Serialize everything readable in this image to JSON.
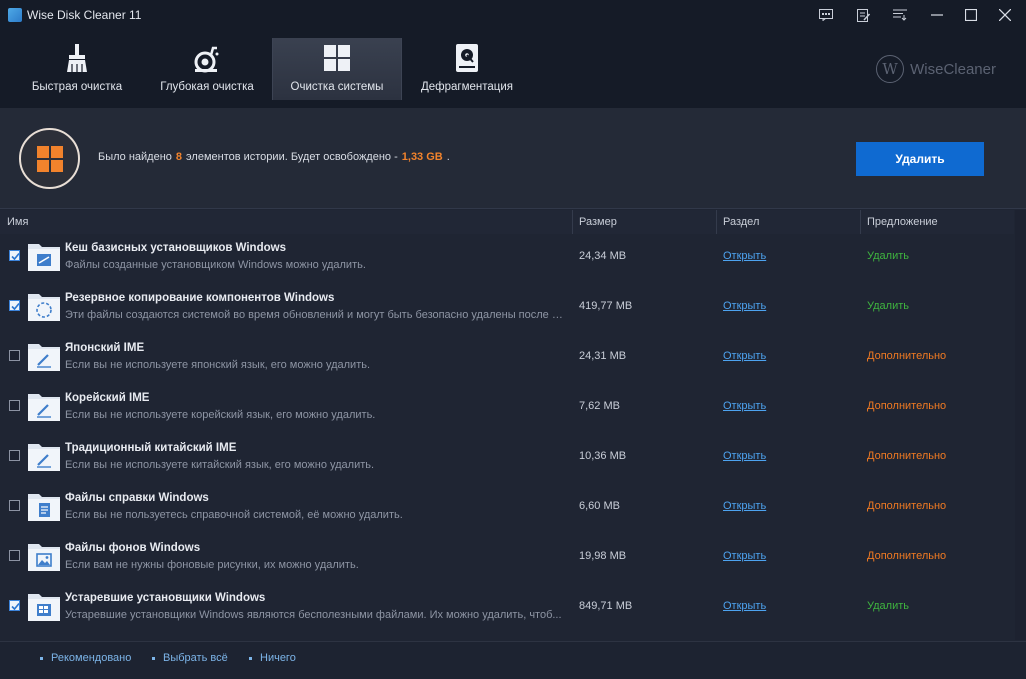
{
  "window": {
    "title": "Wise Disk Cleaner 11"
  },
  "tabs": [
    {
      "label": "Быстрая очистка",
      "icon": "broom-icon"
    },
    {
      "label": "Глубокая очистка",
      "icon": "vacuum-icon"
    },
    {
      "label": "Очистка системы",
      "icon": "windows-icon",
      "active": true
    },
    {
      "label": "Дефрагментация",
      "icon": "disk-icon"
    }
  ],
  "brand": {
    "logo_letter": "W",
    "name": "WiseCleaner"
  },
  "summary": {
    "text_before": "Было найдено",
    "count": "8",
    "text_middle": "элементов истории. Будет освобождено -",
    "size": "1,33 GB",
    "text_after": ".",
    "delete_label": "Удалить"
  },
  "table": {
    "headers": {
      "name": "Имя",
      "size": "Размер",
      "section": "Раздел",
      "suggestion": "Предложение"
    },
    "rows": [
      {
        "checked": true,
        "title": "Кеш базисных установщиков Windows",
        "desc": "Файлы созданные установщиком Windows можно удалить.",
        "size": "24,34 MB",
        "link": "Открыть",
        "suggestion": "Удалить",
        "suggestion_type": "delete",
        "icon": "installer-cache-icon"
      },
      {
        "checked": true,
        "title": "Резервное копирование компонентов Windows",
        "desc": "Эти файлы создаются системой во время обновлений и могут быть безопасно удалены после з...",
        "size": "419,77 MB",
        "link": "Открыть",
        "suggestion": "Удалить",
        "suggestion_type": "delete",
        "icon": "backup-icon"
      },
      {
        "checked": false,
        "title": "Японский IME",
        "desc": "Если вы не используете японский язык, его можно удалить.",
        "size": "24,31 MB",
        "link": "Открыть",
        "suggestion": "Дополнительно",
        "suggestion_type": "more",
        "icon": "pen-icon"
      },
      {
        "checked": false,
        "title": "Корейский IME",
        "desc": "Если вы не используете корейский язык, его можно удалить.",
        "size": "7,62 MB",
        "link": "Открыть",
        "suggestion": "Дополнительно",
        "suggestion_type": "more",
        "icon": "pen-icon"
      },
      {
        "checked": false,
        "title": "Традиционный китайский IME",
        "desc": "Если вы не используете китайский язык, его можно удалить.",
        "size": "10,36 MB",
        "link": "Открыть",
        "suggestion": "Дополнительно",
        "suggestion_type": "more",
        "icon": "pen-icon"
      },
      {
        "checked": false,
        "title": "Файлы справки Windows",
        "desc": "Если вы не пользуетесь справочной системой, её можно удалить.",
        "size": "6,60 MB",
        "link": "Открыть",
        "suggestion": "Дополнительно",
        "suggestion_type": "more",
        "icon": "help-document-icon"
      },
      {
        "checked": false,
        "title": "Файлы фонов Windows",
        "desc": "Если вам не нужны фоновые рисунки, их можно удалить.",
        "size": "19,98 MB",
        "link": "Открыть",
        "suggestion": "Дополнительно",
        "suggestion_type": "more",
        "icon": "picture-icon"
      },
      {
        "checked": true,
        "title": "Устаревшие установщики Windows",
        "desc": "Устаревшие установщики Windows являются бесполезными файлами. Их можно удалить, чтоб...",
        "size": "849,71 MB",
        "link": "Открыть",
        "suggestion": "Удалить",
        "suggestion_type": "delete",
        "icon": "old-installer-icon"
      }
    ]
  },
  "footer": {
    "recommended": "Рекомендовано",
    "select_all": "Выбрать всё",
    "nothing": "Ничего"
  },
  "colors": {
    "accent": "#0f6ad1",
    "highlight": "#f2832c",
    "suggest_delete": "#3fb53f",
    "suggest_more": "#f07a22",
    "link": "#4da3f0"
  }
}
